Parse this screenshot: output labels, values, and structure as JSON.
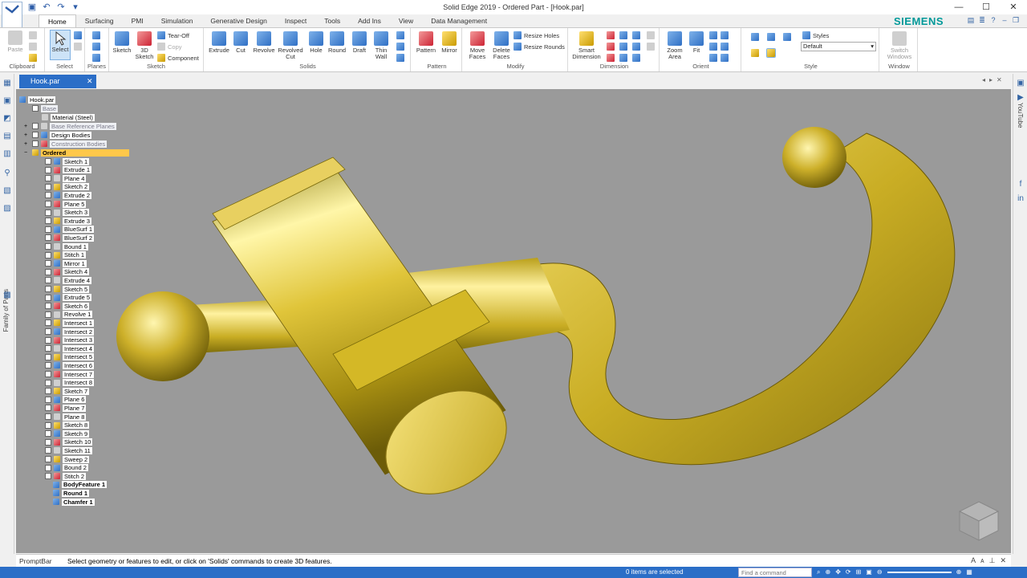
{
  "window": {
    "title": "Solid Edge 2019 - Ordered Part - [Hook.par]"
  },
  "brand": "SIEMENS",
  "tabs": [
    "Home",
    "Surfacing",
    "PMI",
    "Simulation",
    "Generative Design",
    "Inspect",
    "Tools",
    "Add Ins",
    "View",
    "Data Management"
  ],
  "ribbon": {
    "clipboard": {
      "label": "Clipboard",
      "paste": "Paste"
    },
    "select": {
      "label": "Select",
      "select": "Select"
    },
    "planes": {
      "label": "Planes"
    },
    "sketch": {
      "label": "Sketch",
      "sketch": "Sketch",
      "sketch3d": "3D\nSketch",
      "tearoff": "Tear-Off",
      "copy": "Copy",
      "component": "Component"
    },
    "solids": {
      "label": "Solids",
      "extrude": "Extrude",
      "cut": "Cut",
      "revolve": "Revolve",
      "revolved_cut": "Revolved\nCut",
      "hole": "Hole",
      "round": "Round",
      "draft": "Draft",
      "thin_wall": "Thin\nWall"
    },
    "pattern": {
      "label": "Pattern",
      "pattern": "Pattern",
      "mirror": "Mirror"
    },
    "modify": {
      "label": "Modify",
      "move_faces": "Move\nFaces",
      "delete_faces": "Delete\nFaces",
      "resize_holes": "Resize Holes",
      "resize_rounds": "Resize Rounds"
    },
    "dimension": {
      "label": "Dimension",
      "smart_dimension": "Smart\nDimension"
    },
    "orient": {
      "label": "Orient",
      "zoom_area": "Zoom\nArea",
      "fit": "Fit"
    },
    "style": {
      "label": "Style",
      "styles": "Styles",
      "default": "Default"
    },
    "window": {
      "label": "Window",
      "switch_windows": "Switch\nWindows"
    }
  },
  "doc_tab": "Hook.par",
  "left_rail": {
    "family_of_parts": "Family of Parts"
  },
  "right_rail": {
    "youtube": "YouTube"
  },
  "tree": {
    "root": "Hook.par",
    "base": "Base",
    "material": "Material (Steel)",
    "base_ref_planes": "Base Reference Planes",
    "design_bodies": "Design Bodies",
    "construction_bodies": "Construction Bodies",
    "ordered": "Ordered",
    "features": [
      "Sketch 1",
      "Extrude 1",
      "Plane 4",
      "Sketch 2",
      "Extrude 2",
      "Plane 5",
      "Sketch 3",
      "Extrude 3",
      "BlueSurf 1",
      "BlueSurf 2",
      "Bound 1",
      "Stitch 1",
      "Mirror 1",
      "Sketch 4",
      "Extrude 4",
      "Sketch 5",
      "Extrude 5",
      "Sketch 6",
      "Revolve 1",
      "Intersect 1",
      "Intersect 2",
      "Intersect 3",
      "Intersect 4",
      "Intersect 5",
      "Intersect 6",
      "Intersect 7",
      "Intersect 8",
      "Sketch 7",
      "Plane 6",
      "Plane 7",
      "Plane 8",
      "Sketch 8",
      "Sketch 9",
      "Sketch 10",
      "Sketch 11",
      "Sweep 2",
      "Bound 2",
      "Stitch 2"
    ],
    "bold_features": [
      "BodyFeature 1",
      "Round 1",
      "Chamfer 1"
    ]
  },
  "promptbar": {
    "label": "PromptBar",
    "text": "Select geometry or features to edit, or click on 'Solids' commands to create 3D features."
  },
  "status": {
    "count": "0 items are selected",
    "find_placeholder": "Find a command"
  },
  "colors": {
    "accent": "#2b6ec7",
    "brand": "#009999",
    "viewport_bg": "#9a9a9a",
    "gold": "#d4b826",
    "highlight": "#ffc84a"
  }
}
